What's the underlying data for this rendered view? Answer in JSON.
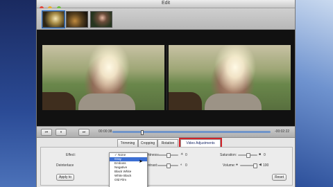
{
  "window": {
    "title": "Edit"
  },
  "thumbnails": [
    "clip-1",
    "clip-2",
    "clip-3"
  ],
  "transport": {
    "buttons": [
      "⏮",
      "⏸",
      "⏭"
    ],
    "current_time": "00:00:38",
    "remaining_time": "-00:02:22",
    "progress_fraction": 0.19
  },
  "tabs": [
    {
      "label": "Trimming",
      "active": false
    },
    {
      "label": "Cropping",
      "active": false
    },
    {
      "label": "Rotation",
      "active": false
    },
    {
      "label": "Video Adjustments",
      "active": true
    }
  ],
  "adjustments": {
    "effect_label": "Effect:",
    "deinterlace_label": "Deinterlace",
    "apply_label": "Apply to",
    "brightness_label": "Brightness:",
    "contrast_label": "Contrast:",
    "saturation_label": "Saturation:",
    "volume_label": "Volume:",
    "brightness_value": "0",
    "contrast_value": "0",
    "saturation_value": "0",
    "volume_value": "100",
    "reset_label": "Reset"
  },
  "effect_options": [
    {
      "label": "None",
      "checked": true
    },
    {
      "label": "Gray",
      "selected": true
    },
    {
      "label": "Emboss"
    },
    {
      "label": "Negative"
    },
    {
      "label": "Black White"
    },
    {
      "label": "White Black"
    },
    {
      "label": "Old Film"
    }
  ],
  "colors": {
    "accent": "#3c6fd3",
    "highlight_box": "#d2232a"
  }
}
